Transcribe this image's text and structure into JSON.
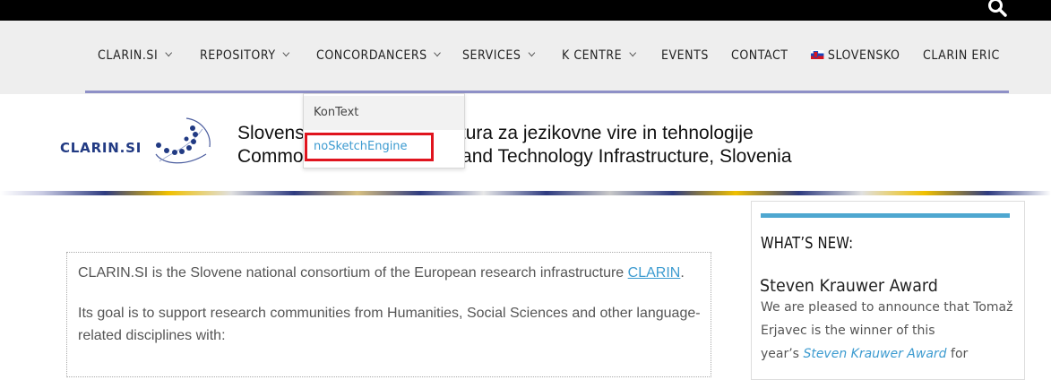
{
  "nav": {
    "items": [
      {
        "label": "CLARIN.SI",
        "has_caret": true
      },
      {
        "label": "REPOSITORY",
        "has_caret": true
      },
      {
        "label": "CONCORDANCERS",
        "has_caret": true
      },
      {
        "label": "SERVICES",
        "has_caret": true
      },
      {
        "label": "K CENTRE",
        "has_caret": true
      },
      {
        "label": "EVENTS",
        "has_caret": false
      },
      {
        "label": "CONTACT",
        "has_caret": false
      },
      {
        "label": "SLOVENSKO",
        "has_caret": false
      },
      {
        "label": "CLARIN ERIC",
        "has_caret": false
      }
    ],
    "search_icon": "search-icon"
  },
  "dropdown": {
    "items": [
      "KonText",
      "noSketchEngine"
    ],
    "highlighted": "noSketchEngine"
  },
  "header": {
    "logo_text": "CLARIN.SI",
    "line1_left": "Slovens",
    "line1_right": "rastruktura za jezikovne vire in tehnologije",
    "line2_left": "Commo",
    "line2_right": "rces and Technology Infrastructure, Slovenia"
  },
  "content": {
    "p1_text": "CLARIN.SI is the Slovene national consortium of the European research infrastructure ",
    "p1_link": "CLARIN",
    "p1_end": ".",
    "p2_line1": "Its goal is to support research communities from Humanities, Social Sciences and other language-",
    "p2_line2": "related disciplines with:"
  },
  "sidebar": {
    "heading": "WHAT’S NEW:",
    "title": "Steven Krauwer Award",
    "line1": "We are pleased to announce that Tomaž",
    "line2": "Erjavec is the winner of this",
    "line3_prefix": "year’s ",
    "line3_link": "Steven Krauwer Award",
    "line3_suffix": " for"
  },
  "colors": {
    "accent_blue": "#3c9bd0",
    "nav_line": "#8e90c7",
    "highlight_red": "#e0141e",
    "logo_navy": "#213a83"
  }
}
